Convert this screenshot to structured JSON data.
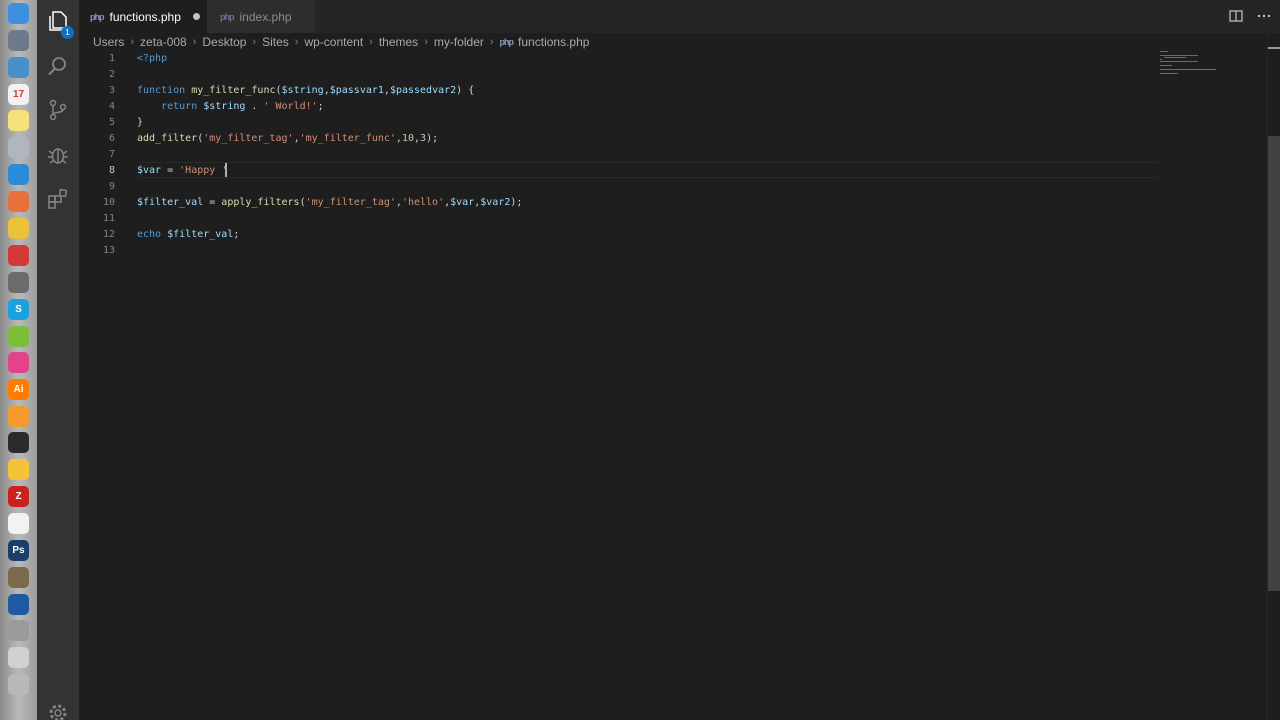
{
  "dock": {
    "apps": [
      "finder-icon",
      "launchpad-icon",
      "preview-icon",
      "calendar-icon",
      "notes-icon",
      "pencil-app-icon",
      "vscode-icon",
      "pyramid-app-icon",
      "chrome-icon",
      "opera-icon",
      "gimp-icon",
      "skype-icon",
      "android-icon",
      "itunes-icon",
      "illustrator-icon",
      "sublime-icon",
      "terminal-icon",
      "cyberduck-icon",
      "filezilla-icon",
      "textedit-icon",
      "photoshop-icon",
      "compass-app-icon",
      "quicktime-icon",
      "archive-icon",
      "flag-app-icon",
      "printer-icon"
    ],
    "illustrator_label": "Ai",
    "photoshop_label": "Ps",
    "skype_label": "S",
    "filezilla_label": "Z",
    "calendar_label": "17"
  },
  "activity_bar": {
    "explorer_badge": "1",
    "icons": [
      "files-icon",
      "search-icon",
      "source-control-icon",
      "debug-icon",
      "extensions-icon",
      "settings-gear-icon"
    ]
  },
  "tabs": [
    {
      "label": "functions.php",
      "active": true,
      "dirty": true
    },
    {
      "label": "index.php",
      "active": false,
      "dirty": false
    }
  ],
  "breadcrumbs": [
    "Users",
    "zeta-008",
    "Desktop",
    "Sites",
    "wp-content",
    "themes",
    "my-folder",
    "functions.php"
  ],
  "editor": {
    "current_line": 8,
    "lines": [
      {
        "n": "1",
        "tokens": [
          {
            "t": "<?php",
            "c": "php"
          }
        ]
      },
      {
        "n": "2",
        "tokens": []
      },
      {
        "n": "3",
        "tokens": [
          {
            "t": "function",
            "c": "kw"
          },
          {
            "t": " ",
            "c": "p"
          },
          {
            "t": "my_filter_func",
            "c": "fn"
          },
          {
            "t": "(",
            "c": "p"
          },
          {
            "t": "$string",
            "c": "var"
          },
          {
            "t": ",",
            "c": "p"
          },
          {
            "t": "$passvar1",
            "c": "var"
          },
          {
            "t": ",",
            "c": "p"
          },
          {
            "t": "$passedvar2",
            "c": "var"
          },
          {
            "t": ") {",
            "c": "p"
          }
        ]
      },
      {
        "n": "4",
        "tokens": [
          {
            "t": "    ",
            "c": "p"
          },
          {
            "t": "return",
            "c": "kw"
          },
          {
            "t": " ",
            "c": "p"
          },
          {
            "t": "$string",
            "c": "var"
          },
          {
            "t": " . ",
            "c": "p"
          },
          {
            "t": "' World!'",
            "c": "str"
          },
          {
            "t": ";",
            "c": "p"
          }
        ]
      },
      {
        "n": "5",
        "tokens": [
          {
            "t": "}",
            "c": "p"
          }
        ]
      },
      {
        "n": "6",
        "tokens": [
          {
            "t": "add_filter",
            "c": "fn"
          },
          {
            "t": "(",
            "c": "p"
          },
          {
            "t": "'my_filter_tag'",
            "c": "str"
          },
          {
            "t": ",",
            "c": "p"
          },
          {
            "t": "'my_filter_func'",
            "c": "str"
          },
          {
            "t": ",",
            "c": "p"
          },
          {
            "t": "10",
            "c": "num"
          },
          {
            "t": ",",
            "c": "p"
          },
          {
            "t": "3",
            "c": "num"
          },
          {
            "t": ");",
            "c": "p"
          }
        ]
      },
      {
        "n": "7",
        "tokens": []
      },
      {
        "n": "8",
        "tokens": [
          {
            "t": "$var",
            "c": "var"
          },
          {
            "t": " = ",
            "c": "p"
          },
          {
            "t": "'Happy ",
            "c": "str"
          },
          {
            "t": "'",
            "c": "str"
          }
        ]
      },
      {
        "n": "9",
        "tokens": []
      },
      {
        "n": "10",
        "tokens": [
          {
            "t": "$filter_val",
            "c": "var"
          },
          {
            "t": " = ",
            "c": "p"
          },
          {
            "t": "apply_filters",
            "c": "fn"
          },
          {
            "t": "(",
            "c": "p"
          },
          {
            "t": "'my_filter_tag'",
            "c": "str"
          },
          {
            "t": ",",
            "c": "p"
          },
          {
            "t": "'hello'",
            "c": "str"
          },
          {
            "t": ",",
            "c": "p"
          },
          {
            "t": "$var",
            "c": "var"
          },
          {
            "t": ",",
            "c": "p"
          },
          {
            "t": "$var2",
            "c": "var"
          },
          {
            "t": ");",
            "c": "p"
          }
        ]
      },
      {
        "n": "11",
        "tokens": []
      },
      {
        "n": "12",
        "tokens": [
          {
            "t": "echo",
            "c": "kw"
          },
          {
            "t": " ",
            "c": "p"
          },
          {
            "t": "$filter_val",
            "c": "var"
          },
          {
            "t": ";",
            "c": "p"
          }
        ]
      },
      {
        "n": "13",
        "tokens": []
      }
    ]
  },
  "colors": {
    "keyword": "#569cd6",
    "function": "#dcdcaa",
    "variable": "#9cdcfe",
    "string": "#ce9178",
    "number": "#b5cea8",
    "punctuation": "#d4d4d4",
    "accent": "#0e70c0"
  }
}
